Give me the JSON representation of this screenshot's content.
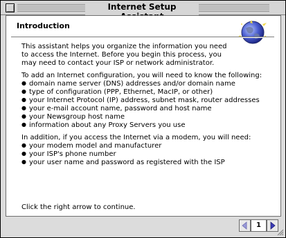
{
  "window": {
    "title": "Internet Setup Assistant"
  },
  "page": {
    "heading": "Introduction",
    "intro_lines": [
      "This assistant helps you organize the information you need",
      "to access the Internet.  Before you begin this process, you",
      "may need to contact your ISP or network administrator."
    ],
    "config_intro": "To add an Internet configuration, you will need to know the following:",
    "config_items": [
      "domain name server (DNS) addresses and/or domain name",
      "type of configuration (PPP, Ethernet, MacIP, or other)",
      "your Internet Protocol (IP) address, subnet mask, router addresses",
      "your e-mail account name, password and host name",
      "your Newsgroup host name",
      "information about any Proxy Servers you use"
    ],
    "modem_intro": "In addition, if you access the Internet via a modem, you will need:",
    "modem_items": [
      "your modem model and manufacturer",
      "your ISP's phone number",
      "your user name and password as registered with the ISP"
    ],
    "footer": "Click the right arrow to continue."
  },
  "navigation": {
    "page_number": "1",
    "prev_icon": "left-arrow-icon",
    "next_icon": "right-arrow-icon"
  },
  "colors": {
    "window_bg": "#dcdcdc",
    "panel_bg": "#ffffff",
    "arrow_disabled": "#9a9ad8",
    "arrow_enabled": "#3b3bb8"
  }
}
